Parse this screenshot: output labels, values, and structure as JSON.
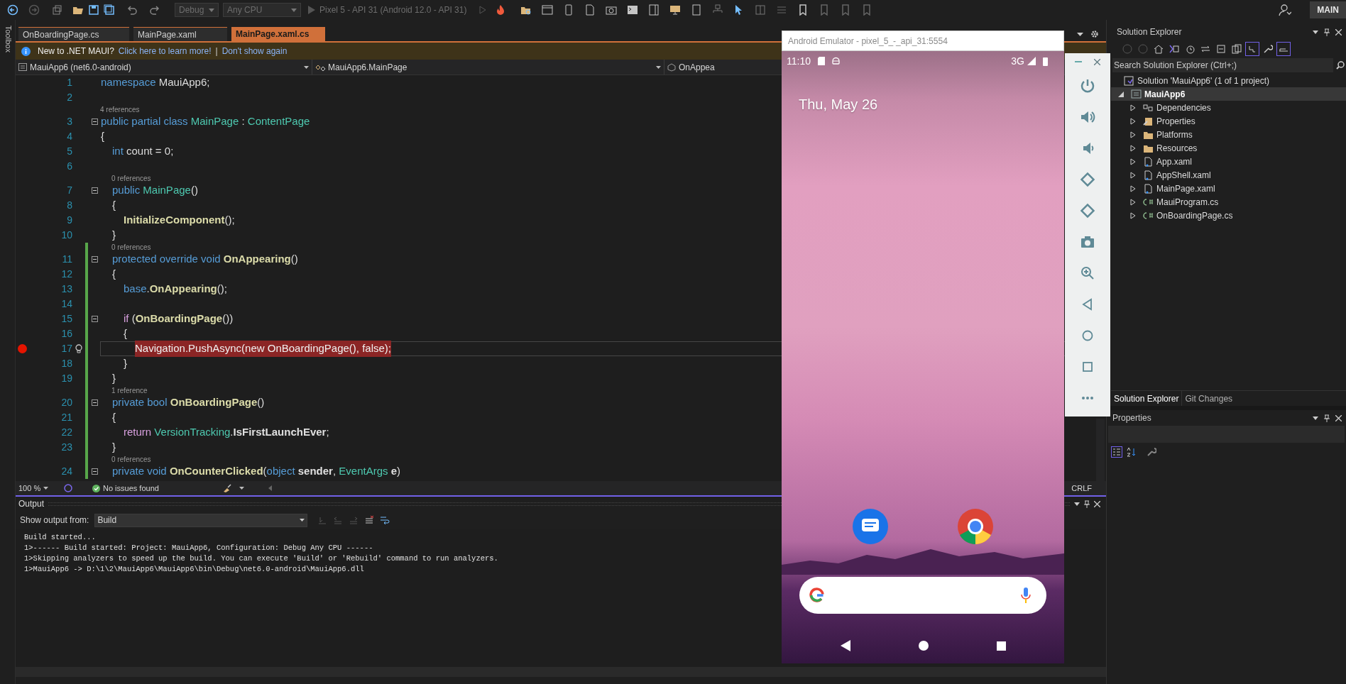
{
  "toolbar": {
    "configuration": {
      "value": "Debug",
      "disabled": true
    },
    "platform": {
      "value": "Any CPU",
      "disabled": true
    },
    "run_target": {
      "label": "Pixel 5 - API 31 (Android 12.0 - API 31)",
      "disabled": true
    },
    "branch": "MAIN"
  },
  "toolbox_label": "Toolbox",
  "tabs": [
    {
      "label": "OnBoardingPage.cs",
      "selected": false
    },
    {
      "label": "MainPage.xaml",
      "selected": false
    },
    {
      "label": "MainPage.xaml.cs",
      "selected": true
    }
  ],
  "info_bar": {
    "message": "New to .NET MAUI?",
    "links": [
      "Click here to learn more!",
      "Don't show again"
    ],
    "separator": "|"
  },
  "nav_bar": {
    "project": "MauiApp6 (net6.0-android)",
    "type": "MauiApp6.MainPage",
    "member": "OnAppea"
  },
  "code": [
    {
      "number": "1",
      "breakpoint": false,
      "current": false,
      "changed": false,
      "fold": false,
      "tokens": [
        {
          "kind": "kw",
          "text": "namespace"
        },
        {
          "kind": "text",
          "text": " MauiApp6;"
        }
      ]
    },
    {
      "number": "2",
      "breakpoint": false,
      "current": false,
      "changed": false,
      "fold": false
    },
    {
      "number": "3",
      "breakpoint": false,
      "current": false,
      "changed": false,
      "fold": true,
      "lens": "4 references",
      "tokens": [
        {
          "kind": "kw",
          "text": "public partial class "
        },
        {
          "kind": "type",
          "text": "MainPage"
        },
        {
          "kind": "text",
          "text": " : "
        },
        {
          "kind": "type",
          "text": "ContentPage"
        }
      ]
    },
    {
      "number": "4",
      "breakpoint": false,
      "current": false,
      "changed": false,
      "fold": false,
      "tokens": [
        {
          "kind": "text",
          "text": "{"
        }
      ]
    },
    {
      "number": "5",
      "breakpoint": false,
      "current": false,
      "changed": false,
      "fold": false,
      "tokens": [
        {
          "kind": "kw",
          "text": "    int"
        },
        {
          "kind": "text",
          "text": " count = 0;"
        }
      ]
    },
    {
      "number": "6",
      "breakpoint": false,
      "current": false,
      "changed": false,
      "fold": false
    },
    {
      "number": "7",
      "breakpoint": false,
      "current": false,
      "changed": false,
      "fold": true,
      "lens": "0 references",
      "tokens": [
        {
          "kind": "kw",
          "text": "    public "
        },
        {
          "kind": "type",
          "text": "MainPage"
        },
        {
          "kind": "text",
          "text": "()"
        }
      ]
    },
    {
      "number": "8",
      "breakpoint": false,
      "current": false,
      "changed": false,
      "fold": false,
      "tokens": [
        {
          "kind": "text",
          "text": "    {"
        }
      ]
    },
    {
      "number": "9",
      "breakpoint": false,
      "current": false,
      "changed": false,
      "fold": false,
      "tokens": [
        {
          "kind": "method",
          "text": "        InitializeComponent"
        },
        {
          "kind": "text",
          "text": "();"
        }
      ]
    },
    {
      "number": "10",
      "breakpoint": false,
      "current": false,
      "changed": false,
      "fold": false,
      "tokens": [
        {
          "kind": "text",
          "text": "    }"
        }
      ]
    },
    {
      "number": "11",
      "breakpoint": false,
      "current": false,
      "changed": true,
      "fold": true,
      "lens": "0 references",
      "tokens": [
        {
          "kind": "kw",
          "text": "    protected override void "
        },
        {
          "kind": "method",
          "text": "OnAppearing"
        },
        {
          "kind": "text",
          "text": "()"
        }
      ]
    },
    {
      "number": "12",
      "breakpoint": false,
      "current": false,
      "changed": true,
      "fold": false,
      "tokens": [
        {
          "kind": "text",
          "text": "    {"
        }
      ]
    },
    {
      "number": "13",
      "breakpoint": false,
      "current": false,
      "changed": true,
      "fold": false,
      "tokens": [
        {
          "kind": "kw",
          "text": "        base"
        },
        {
          "kind": "text",
          "text": "."
        },
        {
          "kind": "method",
          "text": "OnAppearing"
        },
        {
          "kind": "text",
          "text": "();"
        }
      ]
    },
    {
      "number": "14",
      "breakpoint": false,
      "current": false,
      "changed": true,
      "fold": false
    },
    {
      "number": "15",
      "breakpoint": false,
      "current": false,
      "changed": true,
      "fold": true,
      "tokens": [
        {
          "kind": "ctrl",
          "text": "        if"
        },
        {
          "kind": "text",
          "text": " ("
        },
        {
          "kind": "method",
          "text": "OnBoardingPage"
        },
        {
          "kind": "text",
          "text": "())"
        }
      ]
    },
    {
      "number": "16",
      "breakpoint": false,
      "current": false,
      "changed": true,
      "fold": false,
      "tokens": [
        {
          "kind": "text",
          "text": "        {"
        }
      ]
    },
    {
      "number": "17",
      "breakpoint": true,
      "current": true,
      "changed": true,
      "fold": false,
      "tokens": [
        {
          "kind": "text",
          "text": "            Navigation.PushAsync(new OnBoardingPage(), false);"
        }
      ]
    },
    {
      "number": "18",
      "breakpoint": false,
      "current": false,
      "changed": true,
      "fold": false,
      "tokens": [
        {
          "kind": "text",
          "text": "        }"
        }
      ]
    },
    {
      "number": "19",
      "breakpoint": false,
      "current": false,
      "changed": true,
      "fold": false,
      "tokens": [
        {
          "kind": "text",
          "text": "    }"
        }
      ]
    },
    {
      "number": "20",
      "breakpoint": false,
      "current": false,
      "changed": true,
      "fold": true,
      "lens": "1 reference",
      "tokens": [
        {
          "kind": "kw",
          "text": "    private bool "
        },
        {
          "kind": "method",
          "text": "OnBoardingPage"
        },
        {
          "kind": "text",
          "text": "()"
        }
      ]
    },
    {
      "number": "21",
      "breakpoint": false,
      "current": false,
      "changed": true,
      "fold": false,
      "tokens": [
        {
          "kind": "text",
          "text": "    {"
        }
      ]
    },
    {
      "number": "22",
      "breakpoint": false,
      "current": false,
      "changed": true,
      "fold": false,
      "tokens": [
        {
          "kind": "ctrl",
          "text": "        return "
        },
        {
          "kind": "type",
          "text": "VersionTracking"
        },
        {
          "kind": "text",
          "text": "."
        },
        {
          "kind": "param",
          "text": "IsFirstLaunchEver"
        },
        {
          "kind": "text",
          "text": ";"
        }
      ]
    },
    {
      "number": "23",
      "breakpoint": false,
      "current": false,
      "changed": true,
      "fold": false,
      "tokens": [
        {
          "kind": "text",
          "text": "    }"
        }
      ]
    },
    {
      "number": "24",
      "breakpoint": false,
      "current": false,
      "changed": true,
      "fold": true,
      "lens": "0 references",
      "tokens": [
        {
          "kind": "kw",
          "text": "    private void "
        },
        {
          "kind": "method",
          "text": "OnCounterClicked"
        },
        {
          "kind": "text",
          "text": "("
        },
        {
          "kind": "kw",
          "text": "object "
        },
        {
          "kind": "param",
          "text": "sender"
        },
        {
          "kind": "text",
          "text": ", "
        },
        {
          "kind": "type",
          "text": "EventArgs "
        },
        {
          "kind": "param",
          "text": "e"
        },
        {
          "kind": "text",
          "text": ")"
        }
      ]
    }
  ],
  "editor_status": {
    "zoom": "100 %",
    "issues": "No issues found",
    "line_ending": "CRLF"
  },
  "output": {
    "title": "Output",
    "source_label": "Show output from:",
    "source": "Build",
    "lines": [
      "Build started...",
      "1>------ Build started: Project: MauiApp6, Configuration: Debug Any CPU ------",
      "1>Skipping analyzers to speed up the build. You can execute 'Build' or 'Rebuild' command to run analyzers.",
      "1>MauiApp6 -> D:\\1\\2\\MauiApp6\\MauiApp6\\bin\\Debug\\net6.0-android\\MauiApp6.dll"
    ]
  },
  "emulator": {
    "title": "Android Emulator - pixel_5_-_api_31:5554",
    "time": "11:10",
    "network": "3G",
    "date": "Thu, May 26"
  },
  "solution_explorer": {
    "title": "Solution Explorer",
    "search_placeholder": "Search Solution Explorer (Ctrl+;)",
    "tree": [
      {
        "label": "Solution 'MauiApp6' (1 of 1 project)",
        "kind": "solution",
        "selected": false,
        "children": [
          {
            "label": "MauiApp6",
            "kind": "project",
            "selected": true,
            "expanded": true,
            "children": [
              {
                "label": "Dependencies",
                "kind": "dependencies",
                "selected": false,
                "expanded": false
              },
              {
                "label": "Properties",
                "kind": "properties",
                "selected": false,
                "expanded": false
              },
              {
                "label": "Platforms",
                "kind": "folder",
                "selected": false,
                "expanded": false
              },
              {
                "label": "Resources",
                "kind": "folder",
                "selected": false,
                "expanded": false
              },
              {
                "label": "App.xaml",
                "kind": "xaml",
                "selected": false,
                "expanded": false
              },
              {
                "label": "AppShell.xaml",
                "kind": "xaml",
                "selected": false,
                "expanded": false
              },
              {
                "label": "MainPage.xaml",
                "kind": "xaml",
                "selected": false,
                "expanded": false
              },
              {
                "label": "MauiProgram.cs",
                "kind": "csharp",
                "selected": false,
                "expanded": false
              },
              {
                "label": "OnBoardingPage.cs",
                "kind": "csharp",
                "selected": false,
                "expanded": false
              }
            ]
          }
        ]
      }
    ],
    "tabs": [
      {
        "label": "Solution Explorer",
        "selected": true
      },
      {
        "label": "Git Changes",
        "selected": false
      }
    ]
  },
  "properties": {
    "title": "Properties"
  }
}
